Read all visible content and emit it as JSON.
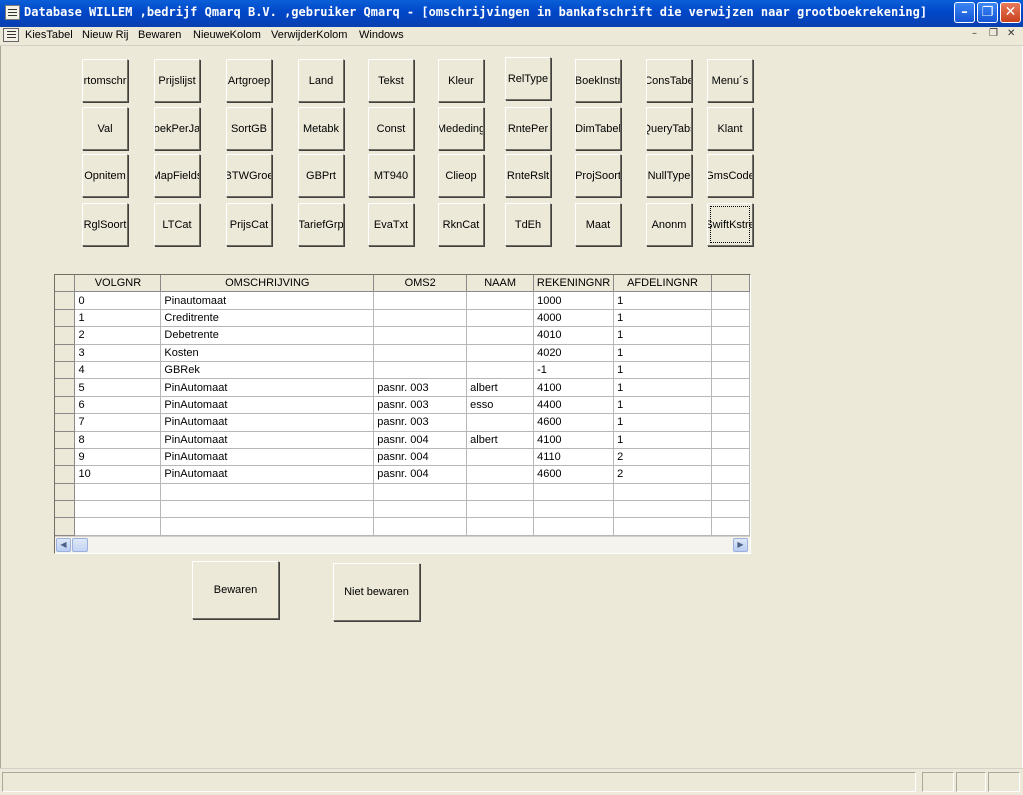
{
  "window": {
    "title": "Database WILLEM ,bedrijf Qmarq B.V. ,gebruiker Qmarq - [omschrijvingen in bankafschrift die verwijzen naar grootboekrekening]",
    "minimize": "–",
    "restore": "❐",
    "close": "✕"
  },
  "menu": {
    "items": [
      "KiesTabel",
      "Nieuw Rij",
      "Bewaren",
      "NieuweKolom",
      "VerwijderKolom",
      "Windows"
    ],
    "mdi_minimize": "–",
    "mdi_restore": "❐",
    "mdi_close": "✕"
  },
  "tables": [
    [
      "rtomschr",
      "Val",
      "Opnitem",
      "RglSoort"
    ],
    [
      "Prijslijst",
      "oekPerJa",
      "MapFields",
      "LTCat"
    ],
    [
      "Artgroep",
      "SortGB",
      "BTWGroe",
      "PrijsCat"
    ],
    [
      "Land",
      "Metabk",
      "GBPrt",
      "TariefGrp"
    ],
    [
      "Tekst",
      "Const",
      "MT940",
      "EvaTxt"
    ],
    [
      "Kleur",
      "Mededing",
      "Clieop",
      "RknCat"
    ],
    [
      "RelType",
      "RntePer",
      "RnteRslt",
      "TdEh"
    ],
    [
      "BoekInstr",
      "DimTabel",
      "ProjSoort",
      "Maat"
    ],
    [
      "ConsTabe",
      "QueryTabs",
      "NullType",
      "Anonm"
    ],
    [
      "Menu´s",
      "Klant",
      "GmsCode",
      "SwiftKstre"
    ]
  ],
  "grid": {
    "columns": [
      "VOLGNR",
      "OMSCHRIJVING",
      "OMS2",
      "NAAM",
      "REKENINGNR",
      "AFDELINGNR"
    ],
    "rows": [
      [
        "0",
        "Pinautomaat",
        "",
        "",
        "1000",
        "1"
      ],
      [
        "1",
        "Creditrente",
        "",
        "",
        "4000",
        "1"
      ],
      [
        "2",
        "Debetrente",
        "",
        "",
        "4010",
        "1"
      ],
      [
        "3",
        "Kosten",
        "",
        "",
        "4020",
        "1"
      ],
      [
        "4",
        "GBRek",
        "",
        "",
        "-1",
        "1"
      ],
      [
        "5",
        "PinAutomaat",
        "pasnr. 003",
        "albert",
        "4100",
        "1"
      ],
      [
        "6",
        "PinAutomaat",
        "pasnr. 003",
        "esso",
        "4400",
        "1"
      ],
      [
        "7",
        "PinAutomaat",
        "pasnr. 003",
        "",
        "4600",
        "1"
      ],
      [
        "8",
        "PinAutomaat",
        "pasnr. 004",
        "albert",
        "4100",
        "1"
      ],
      [
        "9",
        "PinAutomaat",
        "pasnr. 004",
        "",
        "4110",
        "2"
      ],
      [
        "10",
        "PinAutomaat",
        "pasnr. 004",
        "",
        "4600",
        "2"
      ],
      [
        "",
        "",
        "",
        "",
        "",
        ""
      ],
      [
        "",
        "",
        "",
        "",
        "",
        ""
      ],
      [
        "",
        "",
        "",
        "",
        "",
        ""
      ]
    ],
    "scroll_left": "◀",
    "scroll_right": "▶"
  },
  "actions": {
    "save": "Bewaren",
    "cancel": "Niet bewaren"
  }
}
